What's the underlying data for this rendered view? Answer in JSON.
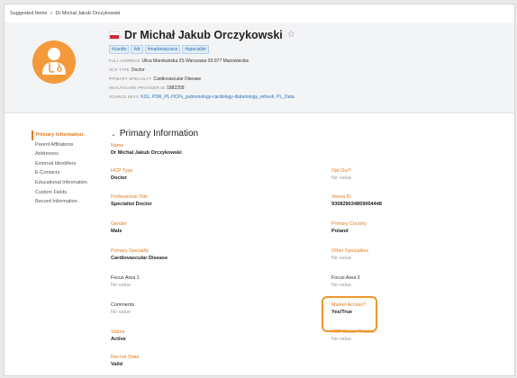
{
  "breadcrumb": {
    "parent": "Suggested Items",
    "separator": ">",
    "current": "Dr Michał Jakub Orczykowski"
  },
  "header": {
    "name": "Dr Michał Jakub Orczykowski",
    "tags": [
      "#cardio",
      "#dr",
      "#marketaccess",
      "#specialist"
    ],
    "full_address_label": "FULL ADDRESS",
    "full_address": "Ulica Marokańska 2S Warszawa 03-977 Mazowieckie",
    "hcp_type_label": "HCP TYPE",
    "hcp_type": "Doctor",
    "primary_specialty_label": "PRIMARY SPECIALTY",
    "primary_specialty": "Cardiovascular Disease",
    "provider_id_label": "HEALTHCARE PROVIDER ID",
    "provider_id": "1882258",
    "source_keys_label": "SOURCE KEYS",
    "source_keys": "KOL, PDR_PL-HCPs_pulmonology-cardiology-diabetology_refresh, PL_Data"
  },
  "nav": [
    "Primary Information",
    "Parent Affiliations",
    "Addresses",
    "External Identifiers",
    "E-Contacts",
    "Educational Information",
    "Custom Fields",
    "Record Information"
  ],
  "section_title": "Primary Information",
  "fields": {
    "name_label": "Name",
    "name_value": "Dr Michal Jakub Orczykowski",
    "hcp_type_label": "HCP Type",
    "hcp_type_value": "Doctor",
    "opt_out_label": "Opt Out?",
    "opt_out_value": "No value",
    "prof_title_label": "Professional Title",
    "prof_title_value": "Specialist Doctor",
    "veeva_id_label": "Veeva ID",
    "veeva_id_value": "930829034859004448",
    "gender_label": "Gender",
    "gender_value": "Male",
    "primary_country_label": "Primary Country",
    "primary_country_value": "Poland",
    "primary_specialty_label": "Primary Specialty",
    "primary_specialty_value": "Cardiovascular Disease",
    "other_specialties_label": "Other Specialties",
    "other_specialties_value": "No value",
    "focus1_label": "Focus Area 1",
    "focus1_value": "No value",
    "focus2_label": "Focus Area 2",
    "focus2_value": "No value",
    "comments_label": "Comments",
    "comments_value": "No value",
    "market_access_label": "Market Access?",
    "market_access_value": "Yes/True",
    "status_label": "Status",
    "status_value": "Active",
    "hcp_status_reason_label": "HCP Status Reason",
    "hcp_status_reason_value": "No value",
    "record_state_label": "Record State",
    "record_state_value": "Valid"
  },
  "colors": {
    "accent": "#e47c1b",
    "avatar": "#f49a3a",
    "link": "#2b6fb3"
  },
  "icons": {
    "avatar": "doctor-avatar-icon",
    "favorite": "star-outline-icon",
    "collapse": "chevron-down-icon",
    "flag": "poland-flag-icon"
  }
}
